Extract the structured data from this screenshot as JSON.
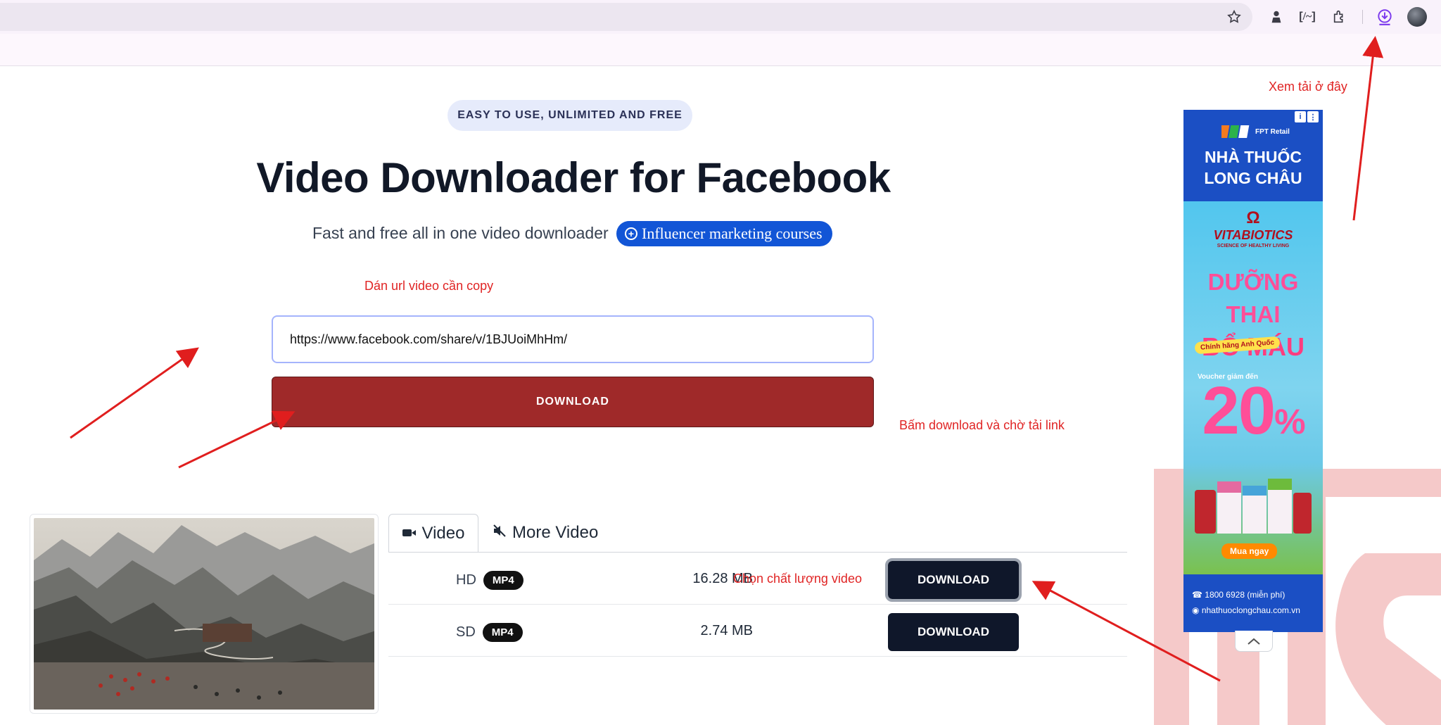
{
  "browser": {
    "icons": [
      "star-icon",
      "user-badge-icon",
      "json-icon",
      "extensions-icon",
      "download-icon"
    ]
  },
  "hero": {
    "badge": "EASY TO USE, UNLIMITED AND FREE",
    "title": "Video Downloader for Facebook",
    "subtitle": "Fast and free all in one video downloader",
    "promo_label": "Influencer marketing courses"
  },
  "form": {
    "url_value": "https://www.facebook.com/share/v/1BJUoiMhHm/",
    "download_label": "DOWNLOAD"
  },
  "annotations": {
    "paste_hint": "Dán url video cần copy",
    "download_hint": "Bấm download và chờ tải link",
    "quality_hint": "Chọn chất lượng video",
    "downloads_hint": "Xem tải ở đây"
  },
  "results": {
    "tabs": [
      {
        "label": "Video",
        "icon": "video-camera-icon",
        "active": true
      },
      {
        "label": "More Video",
        "icon": "muted-speaker-icon",
        "active": false
      }
    ],
    "rows": [
      {
        "quality": "HD",
        "format": "MP4",
        "size": "16.28 MB",
        "button": "DOWNLOAD"
      },
      {
        "quality": "SD",
        "format": "MP4",
        "size": "2.74 MB",
        "button": "DOWNLOAD"
      }
    ]
  },
  "ad": {
    "retailer": "FPT Retail",
    "brand_line1": "NHÀ THUỐC",
    "brand_line2": "LONG CHÂU",
    "sponsor": "VITABIOTICS",
    "sponsor_tagline": "SCIENCE OF HEALTHY LIVING",
    "slogan_line1": "DƯỠNG THAI",
    "slogan_line2": "BỔ MÁU",
    "origin_tag": "Chính hãng Anh Quốc",
    "voucher_label": "Voucher giảm đến",
    "discount": "20",
    "cta": "Mua ngay",
    "phone": "1800 6928 (miễn phí)",
    "website": "nhathuoclongchau.com.vn"
  },
  "colors": {
    "primary_download": "#9f2929",
    "dark_button": "#0f172a",
    "promo_blue": "#1255d6",
    "annotation_red": "#e02424"
  }
}
